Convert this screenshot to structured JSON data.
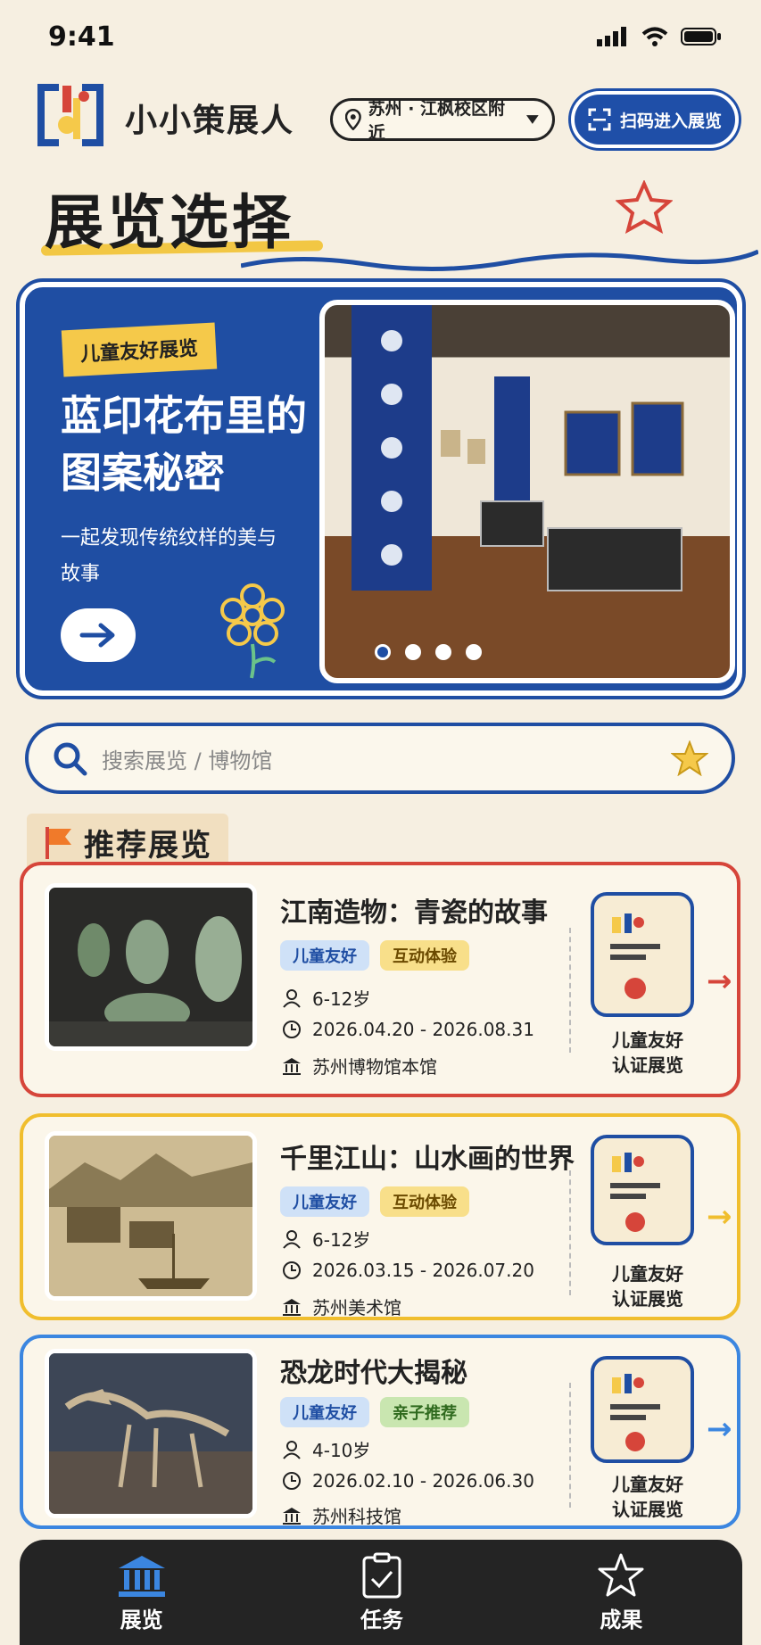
{
  "status": {
    "time": "9:41"
  },
  "header": {
    "app_name": "小小策展人",
    "location": "苏州 · 江枫校区附近",
    "scan_button": "扫码进入展览"
  },
  "page_title": "展览选择",
  "banner": {
    "tag": "儿童友好展览",
    "title": "蓝印花布里的图案秘密",
    "subtitle": "一起发现传统纹样的美与故事",
    "dots": 4,
    "active_dot": 1
  },
  "search": {
    "placeholder": "搜索展览 / 博物馆"
  },
  "section": {
    "title": "推荐展览"
  },
  "cards": [
    {
      "title": "江南造物：青瓷的故事",
      "chips": [
        "儿童友好",
        "互动体验"
      ],
      "age": "6-12岁",
      "dates": "2026.04.20 - 2026.08.31",
      "venue": "苏州博物馆本馆",
      "badge_label_1": "儿童友好",
      "badge_label_2": "认证展览",
      "accent": "#d6453a"
    },
    {
      "title": "千里江山：山水画的世界",
      "chips": [
        "儿童友好",
        "互动体验"
      ],
      "age": "6-12岁",
      "dates": "2026.03.15 - 2026.07.20",
      "venue": "苏州美术馆",
      "badge_label_1": "儿童友好",
      "badge_label_2": "认证展览",
      "accent": "#f0be2e"
    },
    {
      "title": "恐龙时代大揭秘",
      "chips": [
        "儿童友好",
        "亲子推荐"
      ],
      "age": "4-10岁",
      "dates": "2026.02.10 - 2026.06.30",
      "venue": "苏州科技馆",
      "badge_label_1": "儿童友好",
      "badge_label_2": "认证展览",
      "accent": "#3b86e0"
    }
  ],
  "nav": {
    "items": [
      {
        "label": "展览",
        "icon": "museum-icon",
        "active": true
      },
      {
        "label": "任务",
        "icon": "clipboard-check-icon",
        "active": false
      },
      {
        "label": "成果",
        "icon": "star-icon",
        "active": false
      }
    ]
  },
  "colors": {
    "primary_blue": "#1f4ea3",
    "yellow": "#f5c94a",
    "red": "#d6453a",
    "background": "#f6efe1"
  }
}
